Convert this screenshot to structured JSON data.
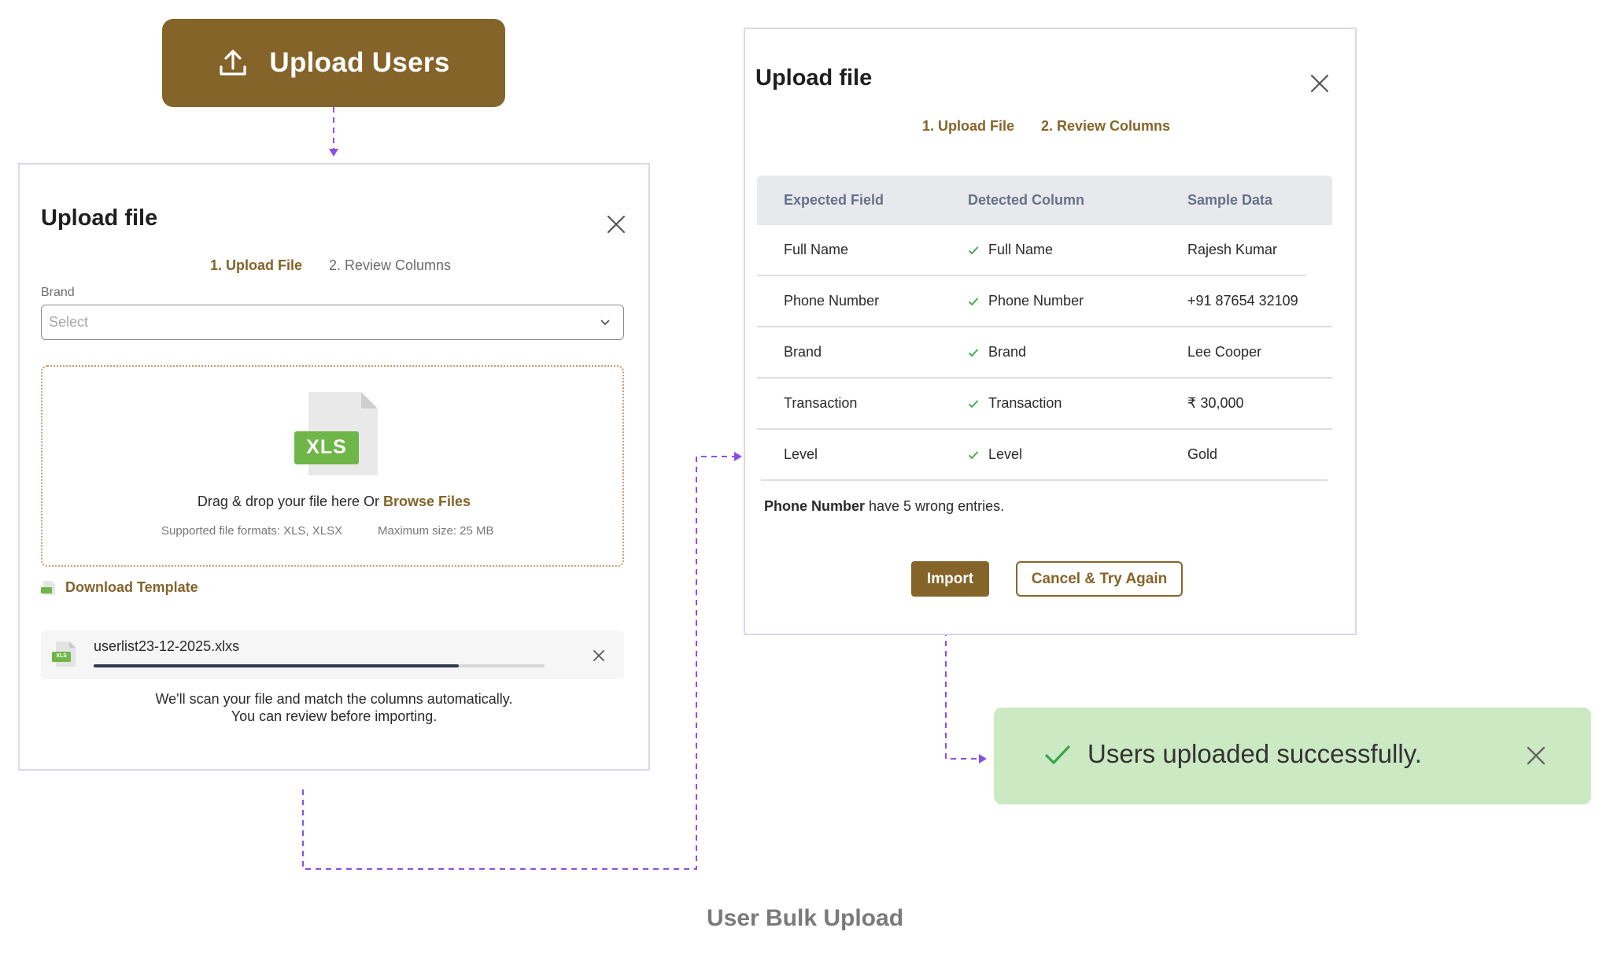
{
  "upload_users_button": {
    "label": "Upload Users",
    "icon": "upload-icon"
  },
  "dialog_upload": {
    "title": "Upload file",
    "steps": [
      "1. Upload File",
      "2. Review Columns"
    ],
    "active_step": 1,
    "brand": {
      "label": "Brand",
      "placeholder": "Select"
    },
    "dropzone": {
      "file_badge": "XLS",
      "drag_text": "Drag & drop your file here Or ",
      "browse_link": "Browse Files",
      "formats": "Supported file formats: XLS, XLSX",
      "max_size": "Maximum size: 25 MB"
    },
    "download_template": "Download Template",
    "file": {
      "icon_badge": "XLS",
      "name": "userlist23-12-2025.xlxs",
      "progress": 0.81
    },
    "info_line1": "We'll scan your file and match the columns automatically.",
    "info_line2": "You can review before importing."
  },
  "dialog_review": {
    "title": "Upload file",
    "steps": [
      "1. Upload File",
      "2. Review Columns"
    ],
    "active_step": 2,
    "table": {
      "headers": [
        "Expected Field",
        "Detected Column",
        "Sample Data"
      ],
      "rows": [
        {
          "expected": "Full Name",
          "detected": "Full Name",
          "sample": "Rajesh Kumar"
        },
        {
          "expected": "Phone Number",
          "detected": "Phone Number",
          "sample": "+91 87654 32109"
        },
        {
          "expected": "Brand",
          "detected": "Brand",
          "sample": "Lee Cooper"
        },
        {
          "expected": "Transaction",
          "detected": "Transaction",
          "sample": "₹ 30,000"
        },
        {
          "expected": "Level",
          "detected": "Level",
          "sample": "Gold"
        }
      ]
    },
    "warning_bold": "Phone Number",
    "warning_rest": " have 5 wrong entries.",
    "import_label": "Import",
    "cancel_label": "Cancel & Try Again"
  },
  "toast": {
    "message": "Users uploaded successfully.",
    "icon": "check-icon"
  },
  "footer_title": "User Bulk Upload",
  "colors": {
    "brand": "#85642a",
    "panel_border": "#d9d6ee",
    "flow_line": "#8a4fe8",
    "toast_bg": "#cbe9c2",
    "success": "#3aa54a",
    "xls_green": "#6fb649"
  }
}
